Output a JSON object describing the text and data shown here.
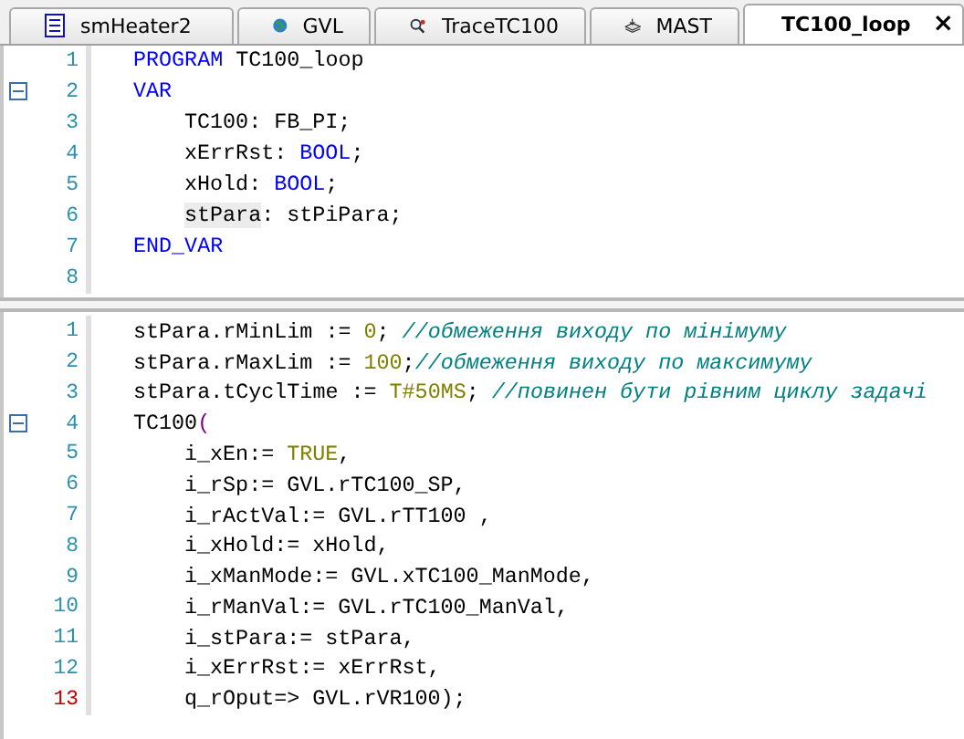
{
  "tabs": [
    {
      "label": "smHeater2",
      "selected": false
    },
    {
      "label": "GVL",
      "selected": false
    },
    {
      "label": "TraceTC100",
      "selected": false
    },
    {
      "label": "MAST",
      "selected": false
    },
    {
      "label": "TC100_loop",
      "selected": true,
      "close": "×"
    }
  ],
  "declaration_pane": {
    "lines": [
      {
        "number": "1",
        "fold": false,
        "marked": false,
        "tokens": [
          {
            "text": "PROGRAM",
            "kind": "keyword"
          },
          {
            "text": " TC100_loop",
            "kind": "plain"
          }
        ]
      },
      {
        "number": "2",
        "fold": true,
        "marked": false,
        "tokens": [
          {
            "text": "VAR",
            "kind": "keyword"
          }
        ],
        "children": [
          {
            "number": "3",
            "fold": false,
            "marked": false,
            "tokens": [
              {
                "text": "TC100: FB_PI;",
                "kind": "plain"
              }
            ]
          },
          {
            "number": "4",
            "fold": false,
            "marked": false,
            "tokens": [
              {
                "text": "xErrRst: ",
                "kind": "plain"
              },
              {
                "text": "BOOL",
                "kind": "keyword"
              },
              {
                "text": ";",
                "kind": "plain"
              }
            ]
          },
          {
            "number": "5",
            "fold": false,
            "marked": false,
            "tokens": [
              {
                "text": "xHold: ",
                "kind": "plain"
              },
              {
                "text": "BOOL",
                "kind": "keyword"
              },
              {
                "text": ";",
                "kind": "plain"
              }
            ]
          },
          {
            "number": "6",
            "fold": false,
            "marked": false,
            "tokens": [
              {
                "text": "stPara",
                "kind": "highlight"
              },
              {
                "text": ": stPiPara;",
                "kind": "plain"
              }
            ]
          }
        ]
      },
      {
        "number": "7",
        "fold": false,
        "marked": false,
        "tokens": [
          {
            "text": "END_VAR",
            "kind": "keyword"
          }
        ]
      },
      {
        "number": "8",
        "fold": false,
        "marked": false
      }
    ]
  },
  "implementation_pane": {
    "lines": [
      {
        "number": "1",
        "fold": false,
        "marked": false,
        "tokens": [
          {
            "text": "stPara.rMinLim := ",
            "kind": "plain"
          },
          {
            "text": "0",
            "kind": "number"
          },
          {
            "text": "; ",
            "kind": "plain"
          },
          {
            "text": "//обмеження виходу по мінімуму",
            "kind": "comment"
          }
        ]
      },
      {
        "number": "2",
        "fold": false,
        "marked": false,
        "tokens": [
          {
            "text": "stPara.rMaxLim := ",
            "kind": "plain"
          },
          {
            "text": "100",
            "kind": "number"
          },
          {
            "text": ";",
            "kind": "plain"
          },
          {
            "text": "//обмеження виходу по максимуму",
            "kind": "comment"
          }
        ]
      },
      {
        "number": "3",
        "fold": false,
        "marked": false,
        "tokens": [
          {
            "text": "stPara.tCyclTime := ",
            "kind": "plain"
          },
          {
            "text": "T#50MS",
            "kind": "number"
          },
          {
            "text": "; ",
            "kind": "plain"
          },
          {
            "text": "//повинен бути рівним циклу задачі",
            "kind": "comment"
          }
        ]
      },
      {
        "number": "4",
        "fold": true,
        "marked": false,
        "tokens": [
          {
            "text": "TC100",
            "kind": "plain"
          },
          {
            "text": "(",
            "kind": "paren"
          }
        ],
        "children": [
          {
            "number": "5",
            "fold": false,
            "marked": false,
            "tokens": [
              {
                "text": "i_xEn:= ",
                "kind": "plain"
              },
              {
                "text": "TRUE",
                "kind": "number"
              },
              {
                "text": ",",
                "kind": "plain"
              }
            ]
          },
          {
            "number": "6",
            "fold": false,
            "marked": false,
            "tokens": [
              {
                "text": "i_rSp:= GVL.rTC100_SP,",
                "kind": "plain"
              }
            ]
          },
          {
            "number": "7",
            "fold": false,
            "marked": false,
            "tokens": [
              {
                "text": "i_rActVal:= GVL.rTT100 ,",
                "kind": "plain"
              }
            ]
          },
          {
            "number": "8",
            "fold": false,
            "marked": false,
            "tokens": [
              {
                "text": "i_xHold:= xHold,",
                "kind": "plain"
              }
            ]
          },
          {
            "number": "9",
            "fold": false,
            "marked": false,
            "tokens": [
              {
                "text": "i_xManMode:= GVL.xTC100_ManMode,",
                "kind": "plain"
              }
            ]
          },
          {
            "number": "10",
            "fold": false,
            "marked": false,
            "tokens": [
              {
                "text": "i_rManVal:= GVL.rTC100_ManVal,",
                "kind": "plain"
              }
            ]
          },
          {
            "number": "11",
            "fold": false,
            "marked": false,
            "tokens": [
              {
                "text": "i_stPara:= stPara,",
                "kind": "plain"
              }
            ]
          },
          {
            "number": "12",
            "fold": false,
            "marked": false,
            "tokens": [
              {
                "text": "i_xErrRst:= xErrRst,",
                "kind": "plain"
              }
            ]
          },
          {
            "number": "13",
            "fold": false,
            "marked": true,
            "tokens": [
              {
                "text": "q_rOput=> GVL.rVR100);",
                "kind": "plain"
              }
            ]
          }
        ]
      }
    ]
  }
}
